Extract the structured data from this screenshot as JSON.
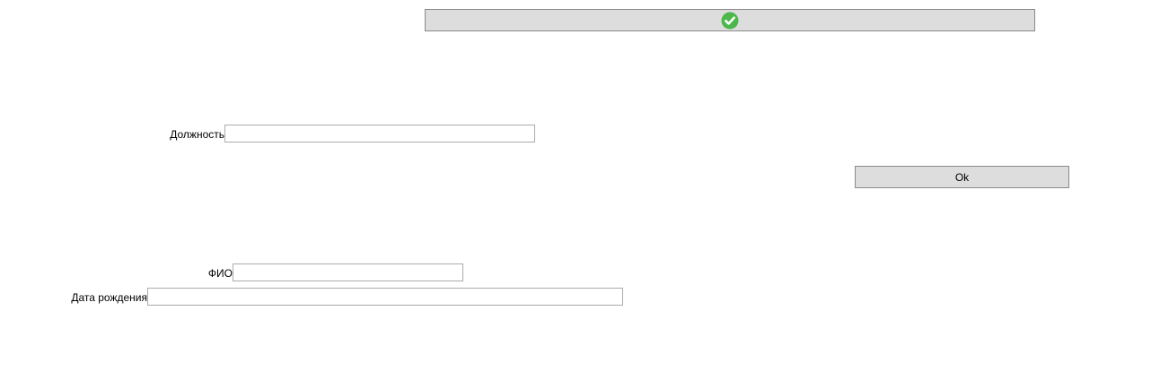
{
  "top_button": {
    "icon": "check-circle-icon",
    "icon_color": "#4cb84c"
  },
  "form": {
    "position": {
      "label": "Должность",
      "value": ""
    },
    "ok_button": {
      "label": "Ok"
    },
    "fio": {
      "label": "ФИО",
      "value": ""
    },
    "birth_date": {
      "label": "Дата рождения",
      "value": ""
    }
  }
}
